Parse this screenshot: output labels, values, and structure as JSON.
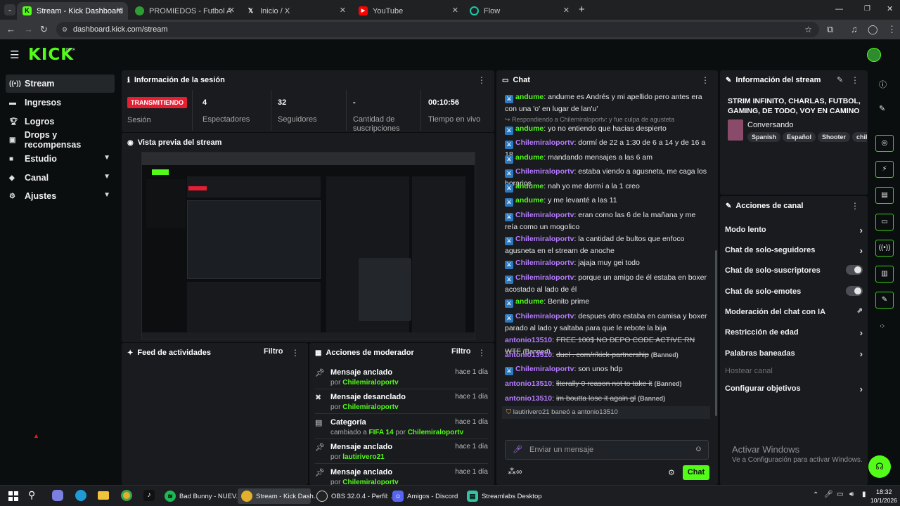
{
  "browser": {
    "tabs": [
      {
        "title": "Stream - Kick Dashboard",
        "active": true
      },
      {
        "title": "PROMIEDOS - Futbol Argentino",
        "active": false
      },
      {
        "title": "Inicio / X",
        "active": false
      },
      {
        "title": "YouTube",
        "active": false
      },
      {
        "title": "Flow",
        "active": false
      }
    ],
    "new_tab": "+",
    "url": "dashboard.kick.com/stream"
  },
  "app": {
    "logo": "KICK",
    "logo_badge": "BETA"
  },
  "sidebar": {
    "items": [
      {
        "label": "Stream",
        "icon": "broadcast-icon",
        "active": true,
        "expandable": false
      },
      {
        "label": "Ingresos",
        "icon": "money-icon",
        "active": false,
        "expandable": false
      },
      {
        "label": "Logros",
        "icon": "trophy-icon",
        "active": false,
        "expandable": false
      },
      {
        "label": "Drops y recompensas",
        "icon": "gift-icon",
        "active": false,
        "expandable": false
      },
      {
        "label": "Estudio",
        "icon": "studio-icon",
        "active": false,
        "expandable": true
      },
      {
        "label": "Canal",
        "icon": "channel-icon",
        "active": false,
        "expandable": true
      },
      {
        "label": "Ajustes",
        "icon": "gear-icon",
        "active": false,
        "expandable": true
      }
    ]
  },
  "session": {
    "title": "Información de la sesión",
    "live_badge": "TRANSMITIENDO",
    "session_label": "Sesión",
    "stats": [
      {
        "value": "4",
        "label": "Espectadores"
      },
      {
        "value": "32",
        "label": "Seguidores"
      },
      {
        "value": "-",
        "label": "Cantidad de suscripciones"
      },
      {
        "value": "00:10:56",
        "label": "Tiempo en vivo"
      }
    ]
  },
  "preview": {
    "title": "Vista previa del stream"
  },
  "activity": {
    "title": "Feed de actividades",
    "filter": "Filtro"
  },
  "moderator": {
    "title": "Acciones de moderador",
    "filter": "Filtro",
    "items": [
      {
        "title": "Mensaje anclado",
        "by_prefix": "por",
        "user": "Chilemiraloportv",
        "time": "hace 1 día",
        "icon": "pin-icon"
      },
      {
        "title": "Mensaje desanclado",
        "by_prefix": "por",
        "user": "Chilemiraloportv",
        "time": "hace 1 día",
        "icon": "unpin-icon"
      },
      {
        "title": "Categoría",
        "by_prefix": "cambiado a",
        "category": "FIFA 14",
        "by2": "por",
        "user": "Chilemiraloportv",
        "time": "hace 1 día",
        "icon": "category-icon"
      },
      {
        "title": "Mensaje anclado",
        "by_prefix": "por",
        "user": "lautirivero21",
        "time": "hace 1 día",
        "icon": "pin-icon"
      },
      {
        "title": "Mensaje anclado",
        "by_prefix": "por",
        "user": "Chilemiraloportv",
        "time": "hace 1 día",
        "icon": "pin-icon"
      }
    ]
  },
  "chat": {
    "title": "Chat",
    "messages": [
      {
        "user": "andume",
        "text": "andume es Andrés y mi apellido pero antes era con una 'o' en lugar de lan'u'"
      },
      {
        "reply": "Respondiendo a Chilemiraloportv: y fue culpa de agusteta"
      },
      {
        "user": "andume",
        "text": "yo no entiendo que hacias despierto"
      },
      {
        "user": "Chilemiraloportv",
        "text": "dormí de 22 a 1:30 de 6 a 14 y de 16 a 18"
      },
      {
        "user": "andume",
        "text": "mandando mensajes a las 6 am"
      },
      {
        "user": "Chilemiraloportv",
        "text": "estaba viendo a agusneta, me caga los horarios"
      },
      {
        "user": "andume",
        "text": "nah yo me dormí a la 1 creo"
      },
      {
        "user": "andume",
        "text": "y me levanté a las 11"
      },
      {
        "user": "Chilemiraloportv",
        "text": "eran como las 6 de la mañana y me reía como un mogolico"
      },
      {
        "user": "Chilemiraloportv",
        "text": "la cantidad de bultos que enfoco agusneta en el stream de anoche"
      },
      {
        "user": "Chilemiraloportv",
        "text": "jajaja muy gei todo"
      },
      {
        "user": "Chilemiraloportv",
        "text": "porque un amigo de él estaba en boxer acostado al lado de él"
      },
      {
        "user": "andume",
        "text": "Benito prime"
      },
      {
        "user": "Chilemiraloportv",
        "text": "despues otro estaba en camisa y boxer parado al lado y saltaba para que le rebote la bija"
      },
      {
        "user": "antonio13510",
        "text": "FREE 100$ NO DEPO CODE ACTIVE RN WTF",
        "banned": "(Banned)"
      },
      {
        "user": "antonio13510",
        "text": "duel . com/r/kick-partnership",
        "banned": "(Banned)"
      },
      {
        "user": "Chilemiraloportv",
        "text": "son unos hdp"
      },
      {
        "user": "antonio13510",
        "text": "literally 0 reason not to take it",
        "banned": "(Banned)"
      },
      {
        "user": "antonio13510",
        "text": "im boutta lose it again gl",
        "banned": "(Banned)"
      }
    ],
    "ban_notice": {
      "mod": "lautirivero21",
      "verb": "baneó a",
      "target": "antonio13510"
    },
    "input_placeholder": "Enviar un mensaje",
    "send_label": "Chat"
  },
  "stream_info": {
    "title": "Información del stream",
    "stream_title": "STRIM INFINITO, CHARLAS, FUTBOL, GAMING, DE TODO, VOY EN CAMINO A...",
    "category": "Conversando",
    "tags": [
      "Spanish",
      "Español",
      "Shooter",
      "chill"
    ]
  },
  "channel_actions": {
    "title": "Acciones de canal",
    "items": [
      {
        "label": "Modo lento",
        "control": "arrow"
      },
      {
        "label": "Chat de solo-seguidores",
        "control": "arrow"
      },
      {
        "label": "Chat de solo-suscriptores",
        "control": "toggle",
        "on": false
      },
      {
        "label": "Chat de solo-emotes",
        "control": "toggle",
        "on": false
      },
      {
        "label": "Moderación del chat con IA",
        "control": "external"
      },
      {
        "label": "Restricción de edad",
        "control": "arrow"
      },
      {
        "label": "Palabras baneadas",
        "control": "arrow"
      },
      {
        "label": "Hostear canal",
        "control": "none",
        "disabled": true
      },
      {
        "label": "Configurar objetivos",
        "control": "arrow"
      }
    ]
  },
  "watermark": {
    "line1": "Activar Windows",
    "line2": "Ve a Configuración para activar Windows."
  },
  "taskbar": {
    "items": [
      {
        "label": "Bad Bunny - NUEV...",
        "icon": "spotify-icon"
      },
      {
        "label": "Stream - Kick Dash...",
        "icon": "chrome-icon",
        "selected": true
      },
      {
        "label": "OBS 32.0.4 - Perfil: ...",
        "icon": "obs-icon"
      },
      {
        "label": "Amigos - Discord",
        "icon": "discord-icon"
      },
      {
        "label": "Streamlabs Desktop",
        "icon": "streamlabs-icon"
      }
    ],
    "time": "18:32",
    "date": "10/1/2026"
  },
  "colors": {
    "accent": "#53fc18",
    "user_purple": "#b77cff",
    "live_red": "#e61e32"
  }
}
